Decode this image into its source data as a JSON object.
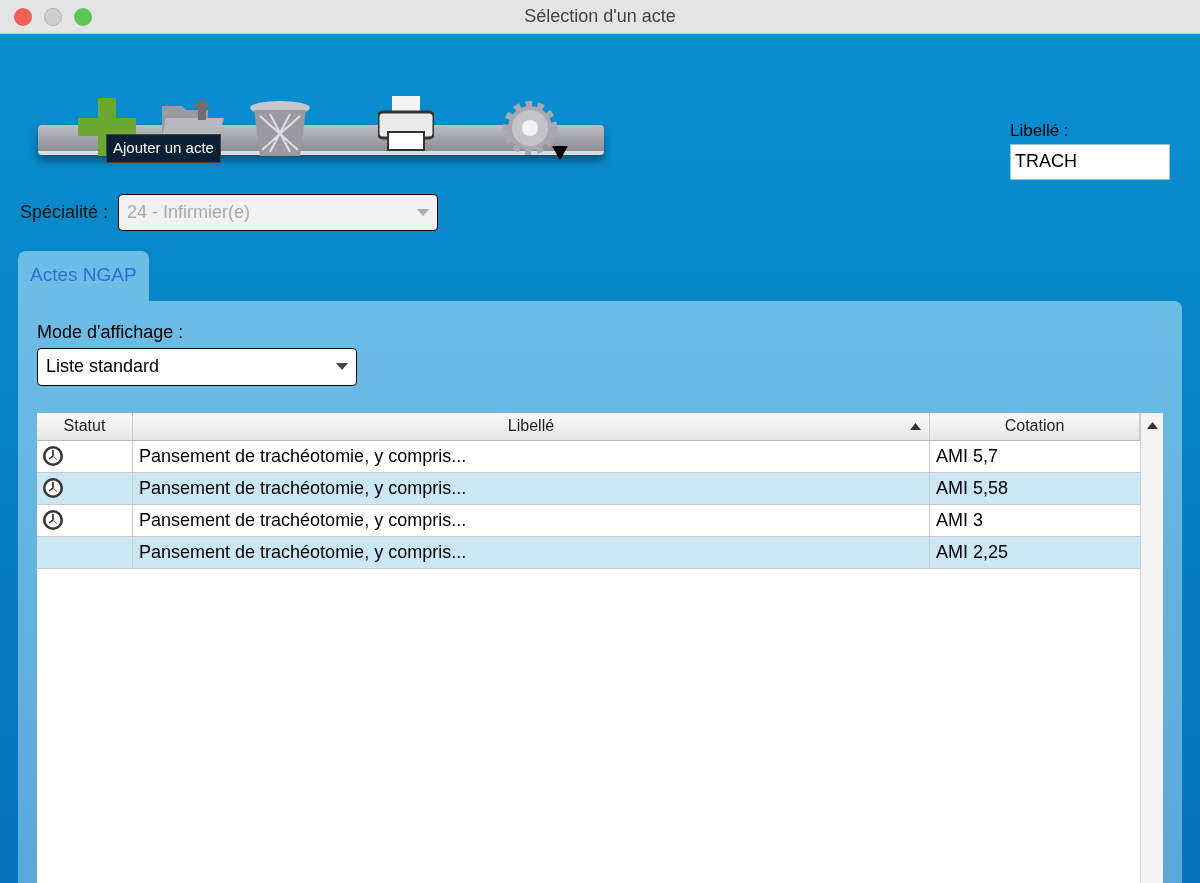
{
  "window": {
    "title": "Sélection d'un acte"
  },
  "toolbar": {
    "tooltip": "Ajouter un acte"
  },
  "filter": {
    "label": "Libellé :",
    "value": "TRACH"
  },
  "specialite": {
    "label": "Spécialité :",
    "value": "24 - Infirmier(e)",
    "disabled": true
  },
  "tabs": [
    {
      "label": "Actes NGAP",
      "selected": true
    }
  ],
  "mode": {
    "label": "Mode d'affichage :",
    "value": "Liste standard"
  },
  "table": {
    "columns": [
      {
        "label": "Statut",
        "sorted": false
      },
      {
        "label": "Libellé",
        "sorted": true
      },
      {
        "label": "Cotation",
        "sorted": false
      }
    ],
    "rows": [
      {
        "pending": true,
        "libelle": "Pansement de trachéotomie, y compris...",
        "cotation": "AMI 5,7"
      },
      {
        "pending": true,
        "libelle": "Pansement de trachéotomie, y compris...",
        "cotation": "AMI 5,58"
      },
      {
        "pending": true,
        "libelle": "Pansement de trachéotomie, y compris...",
        "cotation": "AMI 3"
      },
      {
        "pending": false,
        "libelle": "Pansement de trachéotomie, y compris...",
        "cotation": "AMI 2,25"
      }
    ]
  }
}
